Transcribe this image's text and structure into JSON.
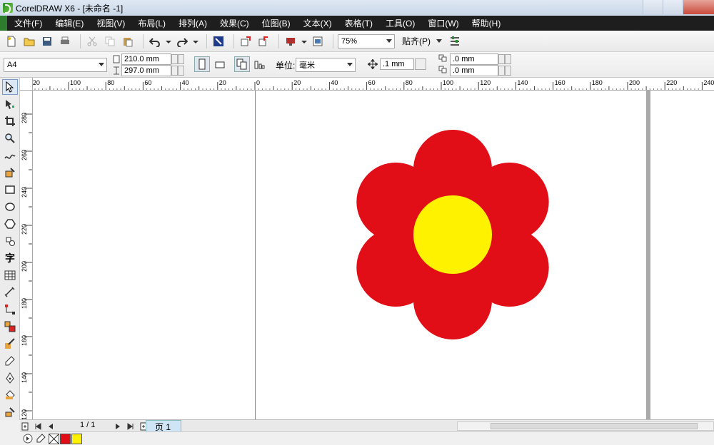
{
  "window": {
    "title": "CorelDRAW X6 - [未命名 -1]"
  },
  "menu": [
    "文件(F)",
    "编辑(E)",
    "视图(V)",
    "布局(L)",
    "排列(A)",
    "效果(C)",
    "位图(B)",
    "文本(X)",
    "表格(T)",
    "工具(O)",
    "窗口(W)",
    "帮助(H)"
  ],
  "toolbar": {
    "zoom": "75%",
    "snap_label": "贴齐(P)"
  },
  "property_bar": {
    "page_size": "A4",
    "width": "210.0 mm",
    "height": "297.0 mm",
    "unit_label": "单位:",
    "unit_value": "毫米",
    "nudge": ".1 mm",
    "dup_x": ".0 mm",
    "dup_y": ".0 mm"
  },
  "rulers": {
    "horizontal": [
      "20",
      "100",
      "80",
      "60",
      "40",
      "20",
      "0",
      "20",
      "40",
      "60",
      "80",
      "100",
      "120",
      "140",
      "160",
      "180",
      "200",
      "220",
      "240"
    ],
    "vertical": [
      "280",
      "260",
      "240",
      "220",
      "200",
      "180",
      "160",
      "140",
      "120"
    ]
  },
  "drawing": {
    "petal_color": "#e20e17",
    "center_color": "#fff200",
    "petals": 6
  },
  "status": {
    "page_info": "1 / 1",
    "page_tab": "页 1"
  },
  "palette": {
    "colors": [
      "#e20e17",
      "#fff200"
    ]
  }
}
